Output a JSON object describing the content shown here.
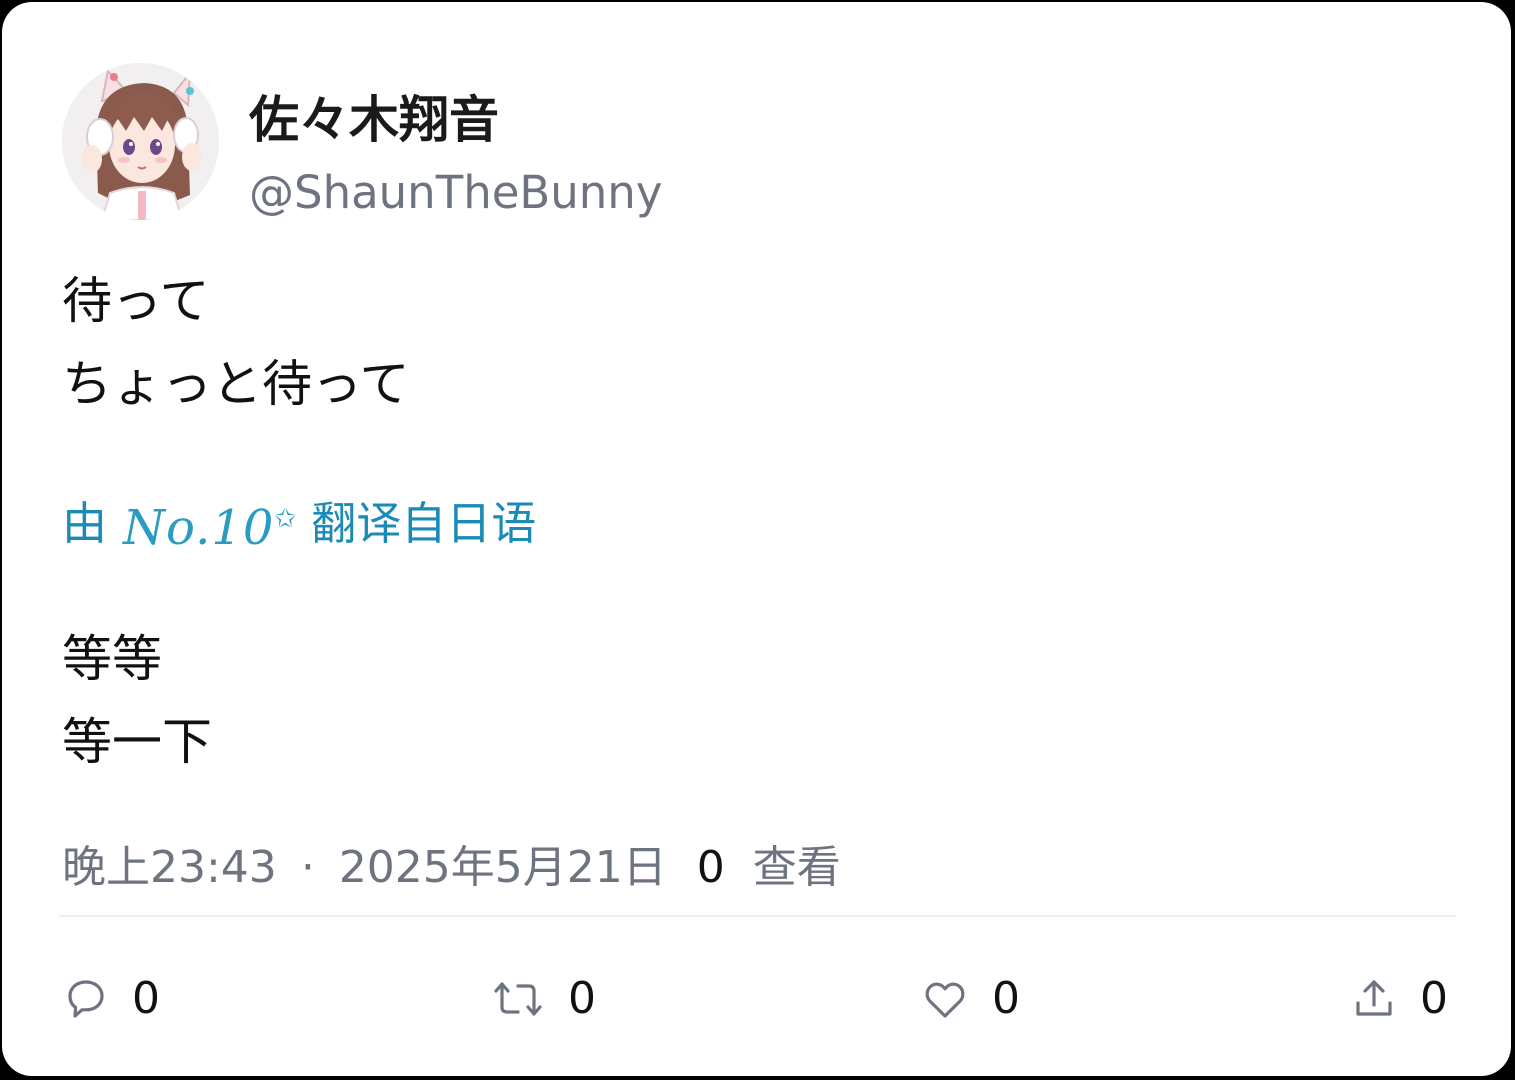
{
  "author": {
    "display_name": "佐々木翔音",
    "handle": "@ShaunTheBunny",
    "avatar_icon": "anime-girl-avatar"
  },
  "post": {
    "original_lines": [
      "待って",
      "ちょっと待って"
    ],
    "translation_label": {
      "prefix": "由",
      "brand": "No.10",
      "suffix": "翻译自日语"
    },
    "translated_lines": [
      "等等",
      "等一下"
    ]
  },
  "meta": {
    "time": "晚上23:43",
    "separator": "·",
    "date": "2025年5月21日",
    "views_count": "0",
    "views_label": "查看"
  },
  "actions": {
    "reply": {
      "icon": "reply-icon",
      "count": "0"
    },
    "retweet": {
      "icon": "retweet-icon",
      "count": "0"
    },
    "like": {
      "icon": "heart-icon",
      "count": "0"
    },
    "share": {
      "icon": "share-icon",
      "count": "0"
    }
  },
  "colors": {
    "accent": "#1b8bb6",
    "secondary_text": "#6e7380",
    "primary_text": "#111111"
  }
}
